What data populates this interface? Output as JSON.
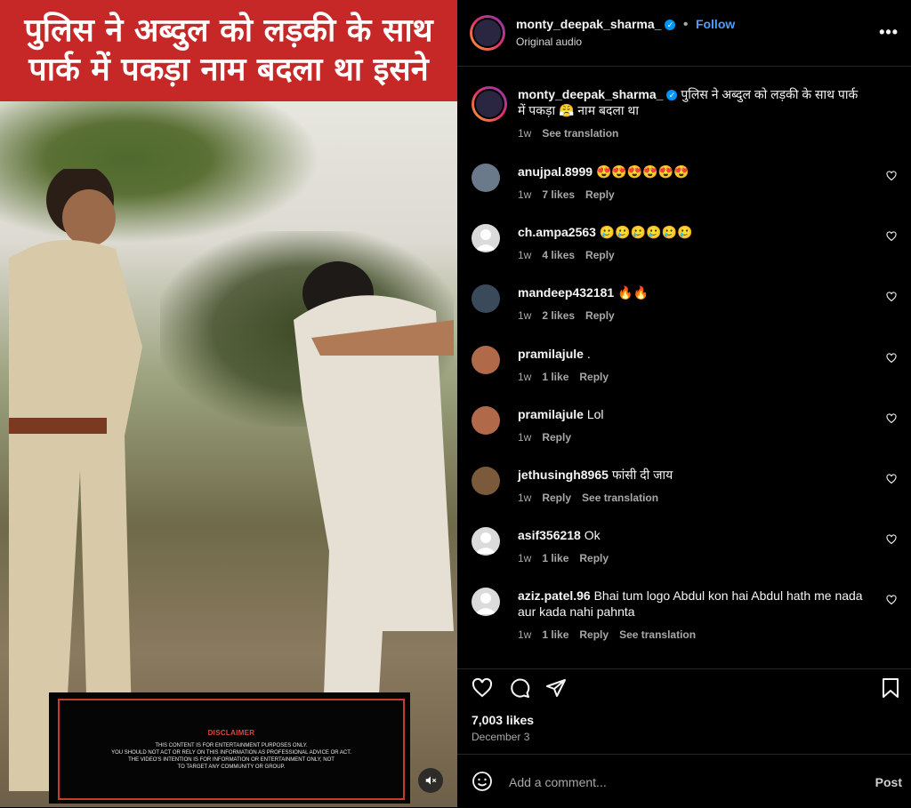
{
  "media": {
    "banner_line1": "पुलिस ने अब्दुल को लड़की के साथ",
    "banner_line2": "पार्क में पकड़ा नाम बदला था इसने",
    "disclaimer_title": "DISCLAIMER",
    "disclaimer_lines": [
      "THIS CONTENT IS FOR ENTERTAINMENT PURPOSES ONLY.",
      "YOU SHOULD NOT ACT OR RELY ON THIS INFORMATION AS PROFESSIONAL ADVICE OR ACT.",
      "THE VIDEO'S INTENTION IS FOR INFORMATION OR ENTERTAINMENT ONLY, NOT",
      "TO TARGET ANY COMMUNITY OR GROUP."
    ],
    "mute_icon": "speaker-muted-icon"
  },
  "header": {
    "username": "monty_deepak_sharma_",
    "verified": "✓",
    "separator": "•",
    "follow": "Follow",
    "audio": "Original audio",
    "more": "•••"
  },
  "caption": {
    "username": "monty_deepak_sharma_",
    "text": "पुलिस ने अब्दुल को लड़की के साथ पार्क में पकड़ा 😤 नाम बदला था",
    "time": "1w",
    "see_translation": "See translation"
  },
  "comments": [
    {
      "username": "anujpal.8999",
      "text": "😍😍😍😍😍😍",
      "time": "1w",
      "likes": "7 likes",
      "reply": "Reply",
      "avatar_color": "#6a7a8a"
    },
    {
      "username": "ch.ampa2563",
      "text": "🥲🥲🥲🥲🥲🥲",
      "time": "1w",
      "likes": "4 likes",
      "reply": "Reply",
      "avatar_color": "#dbdbdb"
    },
    {
      "username": "mandeep432181",
      "text": "🔥🔥",
      "time": "1w",
      "likes": "2 likes",
      "reply": "Reply",
      "avatar_color": "#3a4a5a"
    },
    {
      "username": "pramilajule",
      "text": ".",
      "time": "1w",
      "likes": "1 like",
      "reply": "Reply",
      "avatar_color": "#b06a4a"
    },
    {
      "username": "pramilajule",
      "text": "Lol",
      "time": "1w",
      "likes": "",
      "reply": "Reply",
      "avatar_color": "#b06a4a"
    },
    {
      "username": "jethusingh8965",
      "text": "फांसी दी जाय",
      "time": "1w",
      "likes": "",
      "reply": "Reply",
      "see_translation": "See translation",
      "avatar_color": "#7a5a3a"
    },
    {
      "username": "asif356218",
      "text": "Ok",
      "time": "1w",
      "likes": "1 like",
      "reply": "Reply",
      "avatar_color": "#dbdbdb"
    },
    {
      "username": "aziz.patel.96",
      "text": "Bhai tum logo Abdul kon hai Abdul hath me nada aur kada nahi pahnta",
      "time": "1w",
      "likes": "1 like",
      "reply": "Reply",
      "see_translation": "See translation",
      "avatar_color": "#dbdbdb"
    }
  ],
  "footer": {
    "likes": "7,003 likes",
    "date": "December 3",
    "add_comment_placeholder": "Add a comment...",
    "post": "Post"
  },
  "colors": {
    "banner_red": "#c62828",
    "link_blue": "#4f9cff",
    "verified_blue": "#0095f6",
    "panel_bg": "#000000"
  }
}
